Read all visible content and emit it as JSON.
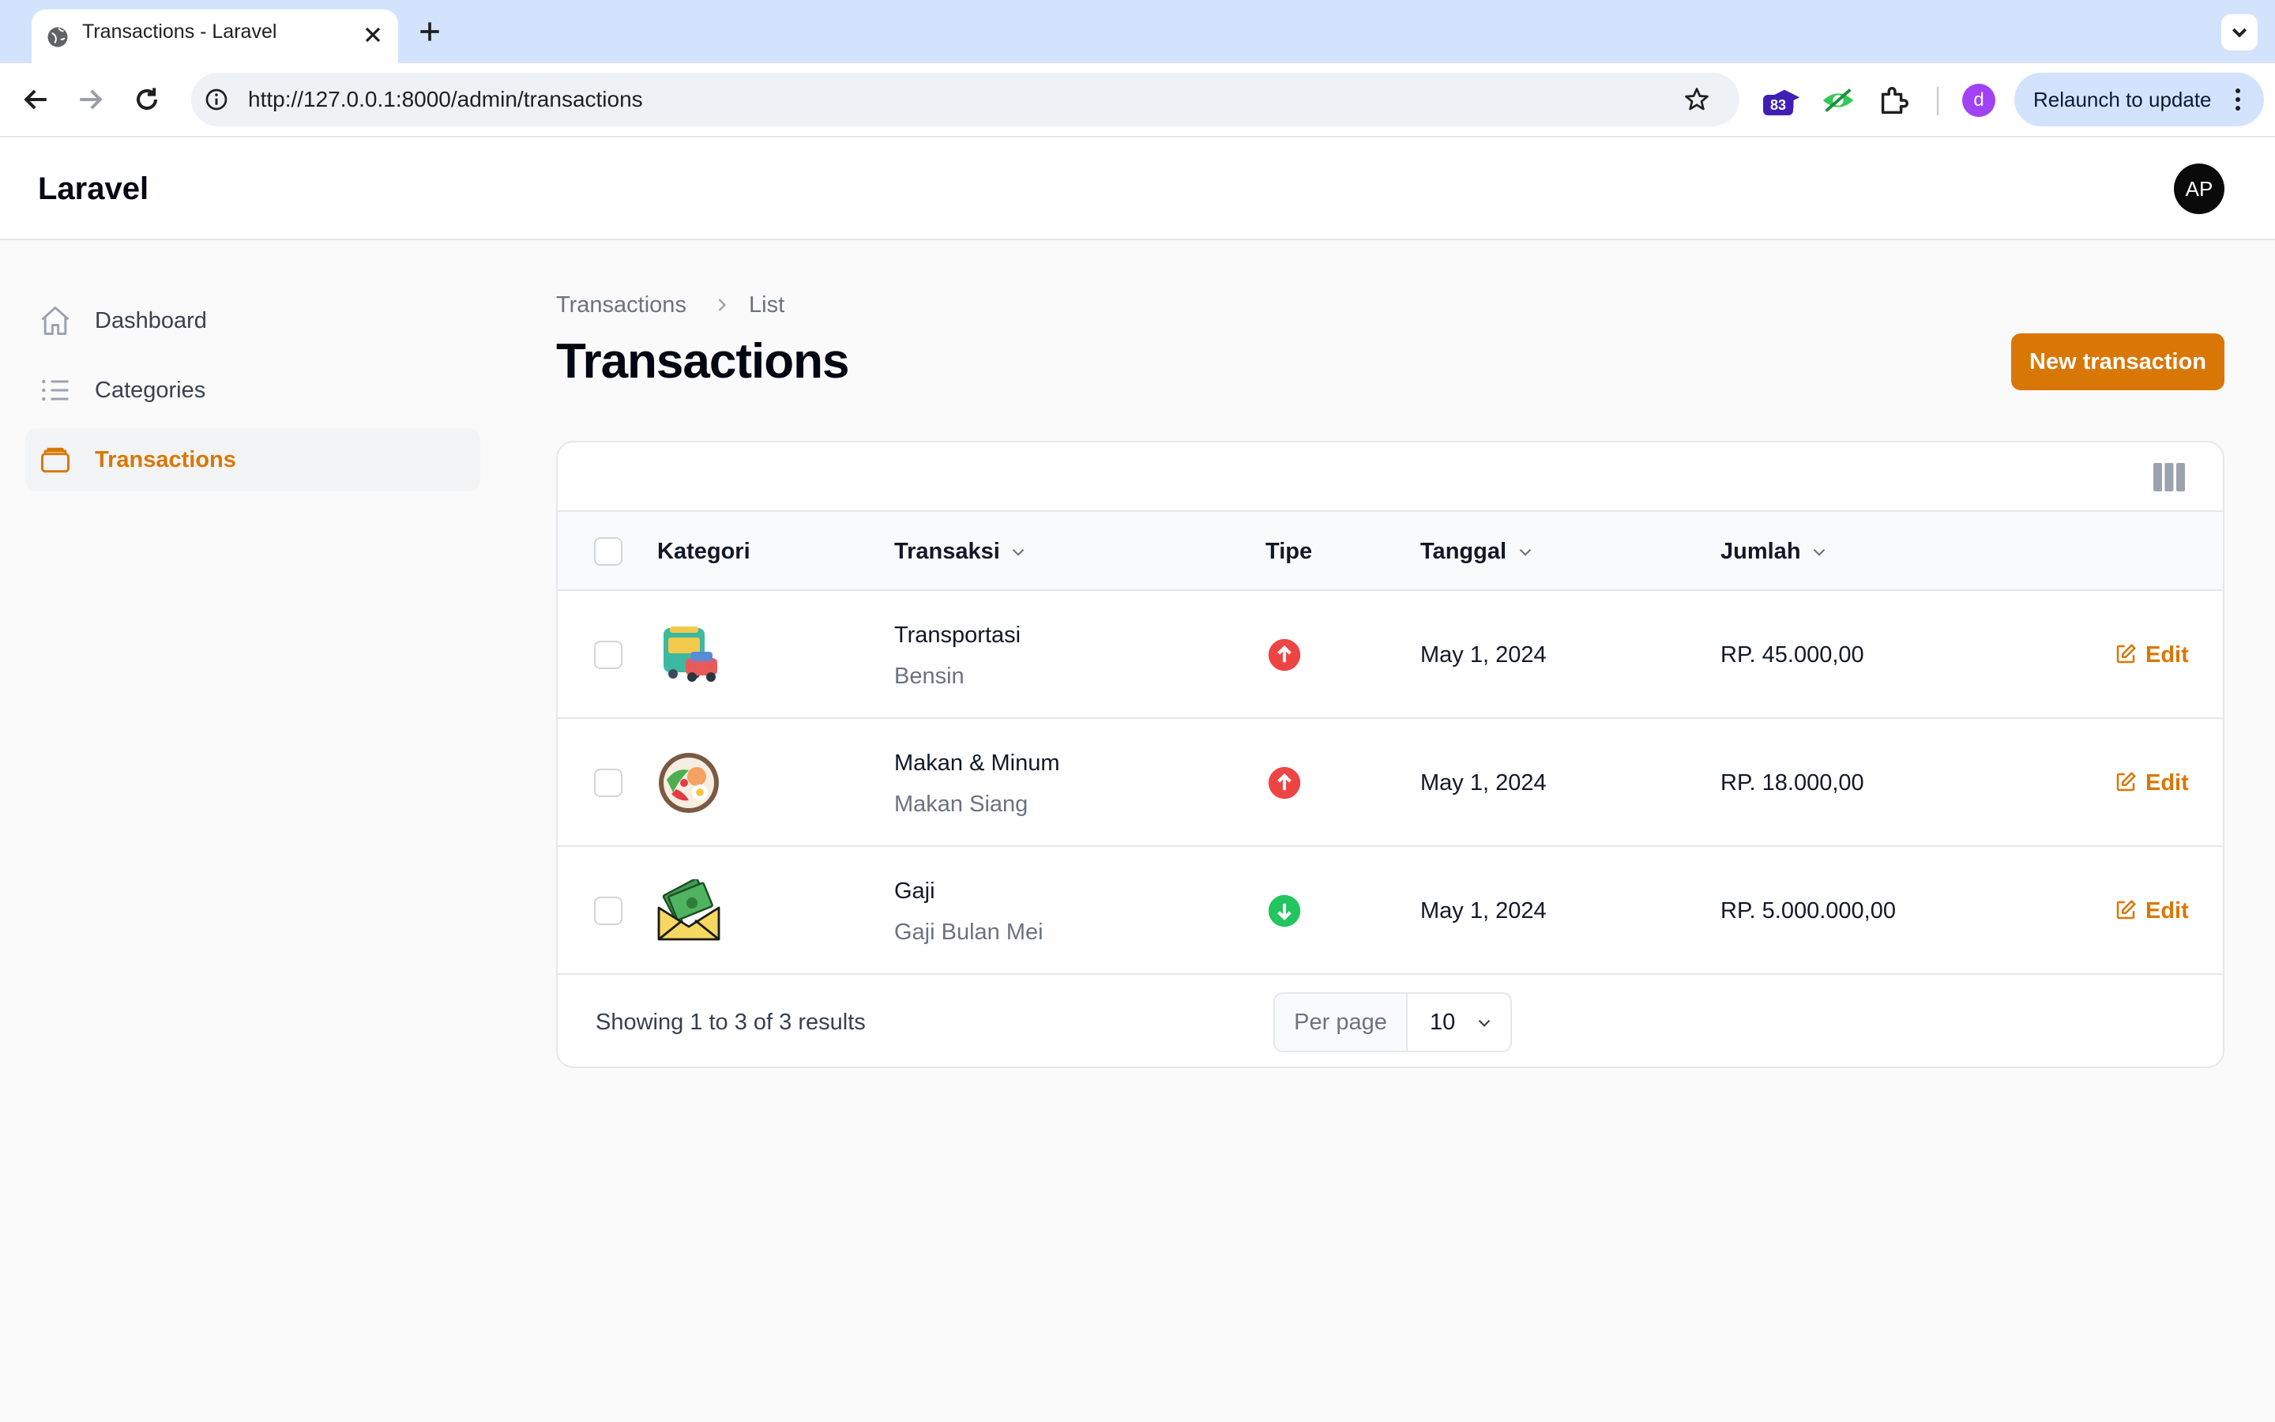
{
  "browser": {
    "tab_title": "Transactions - Laravel",
    "url": "http://127.0.0.1:8000/admin/transactions",
    "extension_badge": "83",
    "profile_initial": "d",
    "relaunch_label": "Relaunch to update"
  },
  "app": {
    "brand": "Laravel",
    "user_initials": "AP"
  },
  "sidebar": {
    "items": [
      {
        "label": "Dashboard",
        "icon": "home-icon",
        "active": false
      },
      {
        "label": "Categories",
        "icon": "list-icon",
        "active": false
      },
      {
        "label": "Transactions",
        "icon": "wallet-icon",
        "active": true
      }
    ]
  },
  "main": {
    "breadcrumb": [
      "Transactions",
      "List"
    ],
    "title": "Transactions",
    "new_button": "New transaction",
    "accent_color": "#d97706"
  },
  "table": {
    "columns": [
      "Kategori",
      "Transaksi",
      "Tipe",
      "Tanggal",
      "Jumlah"
    ],
    "rows": [
      {
        "category_icon": "transport-icon",
        "name": "Transportasi",
        "description": "Bensin",
        "type": "expense",
        "date": "May 1, 2024",
        "amount": "RP. 45.000,00",
        "action": "Edit"
      },
      {
        "category_icon": "food-icon",
        "name": "Makan & Minum",
        "description": "Makan Siang",
        "type": "expense",
        "date": "May 1, 2024",
        "amount": "RP. 18.000,00",
        "action": "Edit"
      },
      {
        "category_icon": "salary-icon",
        "name": "Gaji",
        "description": "Gaji Bulan Mei",
        "type": "income",
        "date": "May 1, 2024",
        "amount": "RP. 5.000.000,00",
        "action": "Edit"
      }
    ]
  },
  "pagination": {
    "summary": "Showing 1 to 3 of 3 results",
    "per_page_label": "Per page",
    "per_page_value": "10"
  }
}
